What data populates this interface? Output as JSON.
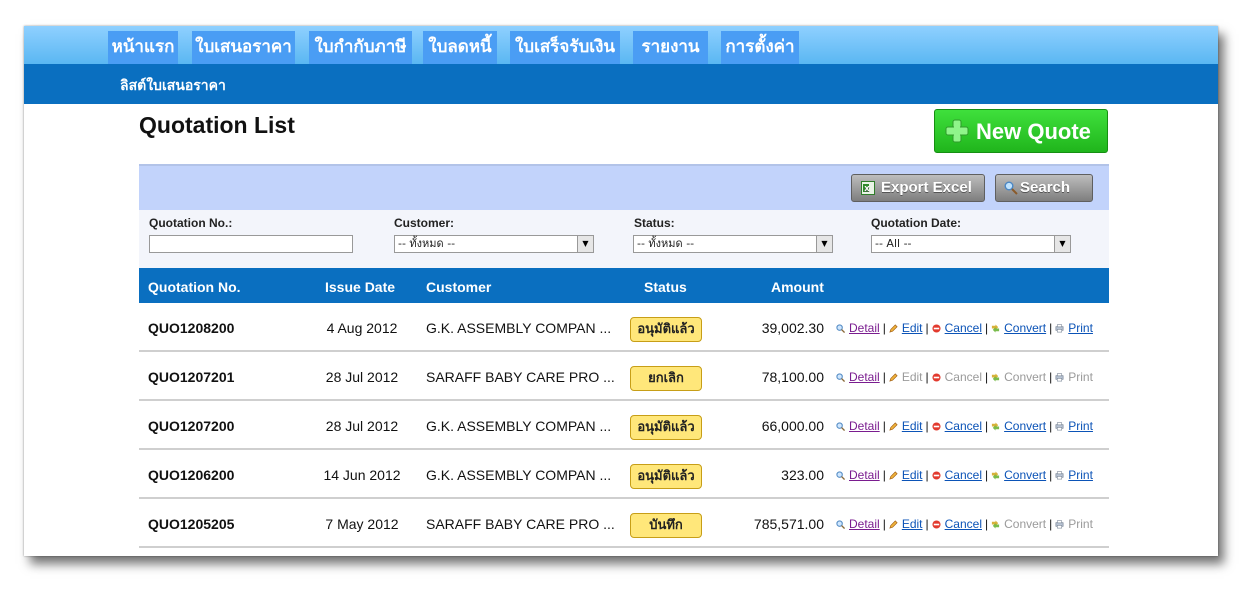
{
  "nav": {
    "items": [
      {
        "label": "หน้าแรก"
      },
      {
        "label": "ใบเสนอราคา"
      },
      {
        "label": "ใบกำกับภาษี"
      },
      {
        "label": "ใบลดหนี้"
      },
      {
        "label": "ใบเสร็จรับเงิน"
      },
      {
        "label": "รายงาน"
      },
      {
        "label": "การตั้งค่า"
      }
    ],
    "sub_item": "ลิสต์ใบเสนอราคา"
  },
  "page": {
    "title": "Quotation List",
    "new_button": "New Quote"
  },
  "toolbar": {
    "export_label": "Export Excel",
    "search_label": "Search"
  },
  "filters": {
    "quotation_no_label": "Quotation No.:",
    "quotation_no_value": "",
    "customer_label": "Customer:",
    "customer_value": "-- ทั้งหมด --",
    "status_label": "Status:",
    "status_value": "-- ทั้งหมด --",
    "date_label": "Quotation Date:",
    "date_value": "-- All --"
  },
  "table": {
    "headers": {
      "quotation_no": "Quotation No.",
      "issue_date": "Issue Date",
      "customer": "Customer",
      "status": "Status",
      "amount": "Amount"
    },
    "action_labels": {
      "detail": "Detail",
      "edit": "Edit",
      "cancel": "Cancel",
      "convert": "Convert",
      "print": "Print"
    },
    "rows": [
      {
        "number": "QUO1208200",
        "date": "4 Aug 2012",
        "customer": "G.K. ASSEMBLY COMPAN ...",
        "status": "อนุมัติแล้ว",
        "amount": "39,002.30",
        "edit_enabled": true,
        "cancel_enabled": true,
        "convert_enabled": true,
        "print_enabled": true
      },
      {
        "number": "QUO1207201",
        "date": "28 Jul 2012",
        "customer": "SARAFF BABY CARE PRO ...",
        "status": "ยกเลิก",
        "amount": "78,100.00",
        "edit_enabled": false,
        "cancel_enabled": false,
        "convert_enabled": false,
        "print_enabled": false
      },
      {
        "number": "QUO1207200",
        "date": "28 Jul 2012",
        "customer": "G.K. ASSEMBLY COMPAN ...",
        "status": "อนุมัติแล้ว",
        "amount": "66,000.00",
        "edit_enabled": true,
        "cancel_enabled": true,
        "convert_enabled": true,
        "print_enabled": true
      },
      {
        "number": "QUO1206200",
        "date": "14 Jun 2012",
        "customer": "G.K. ASSEMBLY COMPAN ...",
        "status": "อนุมัติแล้ว",
        "amount": "323.00",
        "edit_enabled": true,
        "cancel_enabled": true,
        "convert_enabled": true,
        "print_enabled": true
      },
      {
        "number": "QUO1205205",
        "date": "7 May 2012",
        "customer": "SARAFF BABY CARE PRO ...",
        "status": "บันทึก",
        "amount": "785,571.00",
        "edit_enabled": true,
        "cancel_enabled": true,
        "convert_enabled": false,
        "print_enabled": false
      }
    ]
  }
}
